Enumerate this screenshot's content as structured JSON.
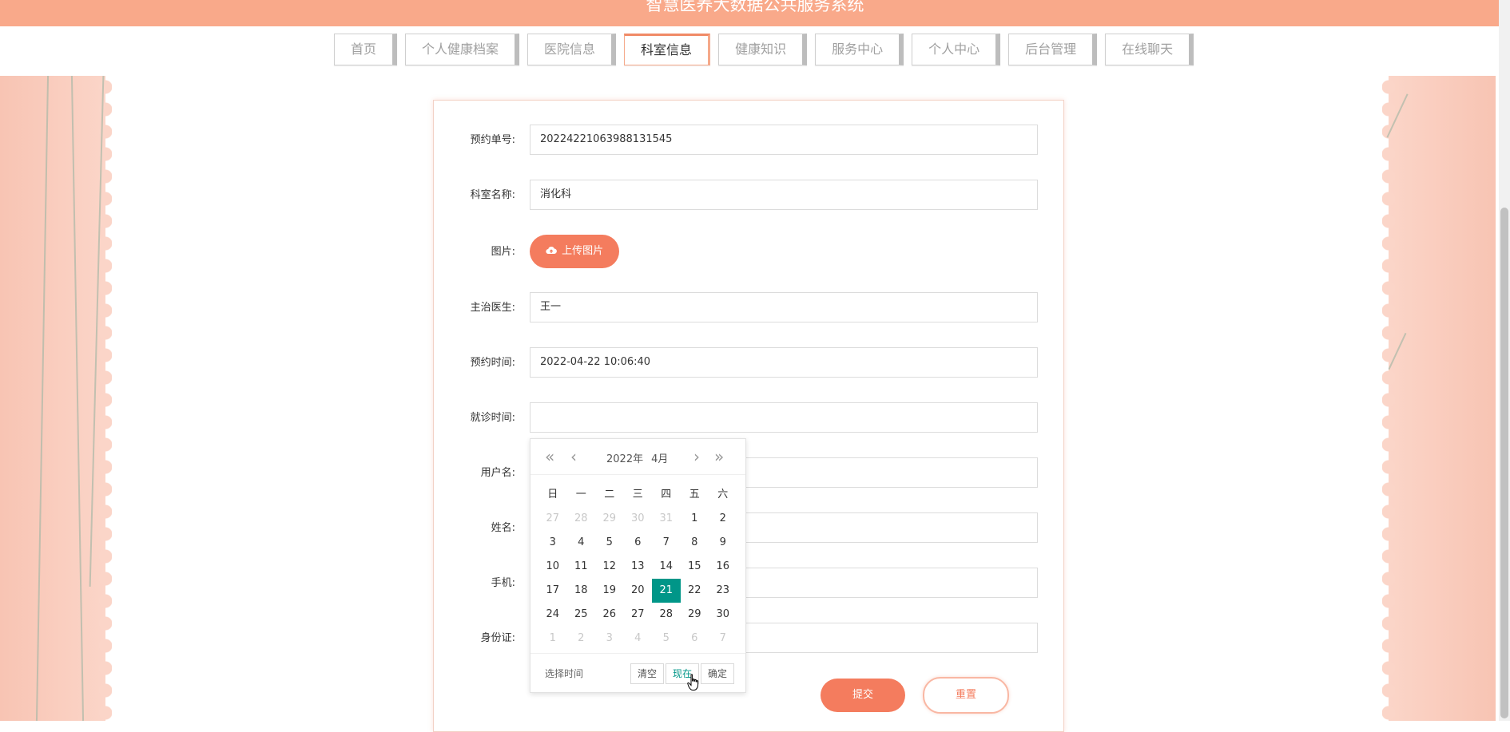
{
  "app": {
    "title": "智慧医养大数据公共服务系统"
  },
  "nav": [
    {
      "label": "首页",
      "active": false
    },
    {
      "label": "个人健康档案",
      "active": false
    },
    {
      "label": "医院信息",
      "active": false
    },
    {
      "label": "科室信息",
      "active": true
    },
    {
      "label": "健康知识",
      "active": false
    },
    {
      "label": "服务中心",
      "active": false
    },
    {
      "label": "个人中心",
      "active": false
    },
    {
      "label": "后台管理",
      "active": false
    },
    {
      "label": "在线聊天",
      "active": false
    }
  ],
  "form": {
    "order_no": {
      "label": "预约单号:",
      "value": "20224221063988131545"
    },
    "dept_name": {
      "label": "科室名称:",
      "value": "消化科"
    },
    "image": {
      "label": "图片:",
      "button": "上传图片"
    },
    "doctor": {
      "label": "主治医生:",
      "value": "王一"
    },
    "appt_time": {
      "label": "预约时间:",
      "value": "2022-04-22 10:06:40"
    },
    "visit_time": {
      "label": "就诊时间:",
      "value": ""
    },
    "username": {
      "label": "用户名:",
      "value": ""
    },
    "name": {
      "label": "姓名:",
      "value": ""
    },
    "phone": {
      "label": "手机:",
      "value": ""
    },
    "idcard": {
      "label": "身份证:",
      "value": ""
    },
    "submit": "提交",
    "reset": "重置"
  },
  "datepicker": {
    "year": "2022年",
    "month": "4月",
    "weekdays": [
      "日",
      "一",
      "二",
      "三",
      "四",
      "五",
      "六"
    ],
    "days": [
      {
        "d": "27",
        "m": true
      },
      {
        "d": "28",
        "m": true
      },
      {
        "d": "29",
        "m": true
      },
      {
        "d": "30",
        "m": true
      },
      {
        "d": "31",
        "m": true
      },
      {
        "d": "1"
      },
      {
        "d": "2"
      },
      {
        "d": "3"
      },
      {
        "d": "4"
      },
      {
        "d": "5"
      },
      {
        "d": "6"
      },
      {
        "d": "7"
      },
      {
        "d": "8"
      },
      {
        "d": "9"
      },
      {
        "d": "10"
      },
      {
        "d": "11"
      },
      {
        "d": "12"
      },
      {
        "d": "13"
      },
      {
        "d": "14"
      },
      {
        "d": "15"
      },
      {
        "d": "16"
      },
      {
        "d": "17"
      },
      {
        "d": "18"
      },
      {
        "d": "19"
      },
      {
        "d": "20"
      },
      {
        "d": "21",
        "sel": true
      },
      {
        "d": "22"
      },
      {
        "d": "23"
      },
      {
        "d": "24"
      },
      {
        "d": "25"
      },
      {
        "d": "26"
      },
      {
        "d": "27"
      },
      {
        "d": "28"
      },
      {
        "d": "29"
      },
      {
        "d": "30"
      },
      {
        "d": "1",
        "m": true
      },
      {
        "d": "2",
        "m": true
      },
      {
        "d": "3",
        "m": true
      },
      {
        "d": "4",
        "m": true
      },
      {
        "d": "5",
        "m": true
      },
      {
        "d": "6",
        "m": true
      },
      {
        "d": "7",
        "m": true
      }
    ],
    "footer_label": "选择时间",
    "clear": "清空",
    "now": "现在",
    "confirm": "确定"
  }
}
